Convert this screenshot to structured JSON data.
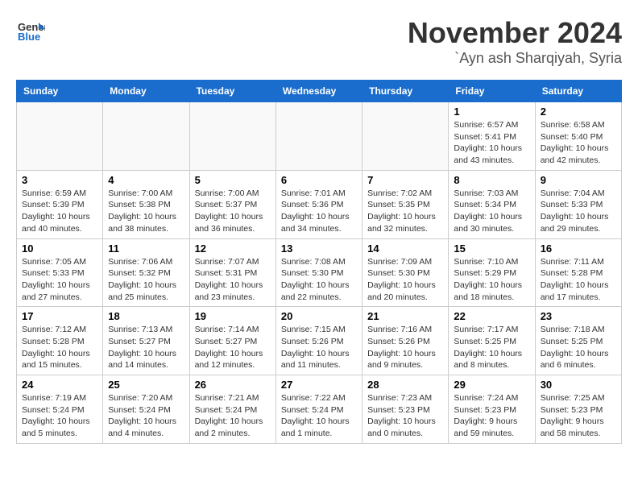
{
  "header": {
    "logo_general": "General",
    "logo_blue": "Blue",
    "month": "November 2024",
    "location": "`Ayn ash Sharqiyah, Syria"
  },
  "weekdays": [
    "Sunday",
    "Monday",
    "Tuesday",
    "Wednesday",
    "Thursday",
    "Friday",
    "Saturday"
  ],
  "weeks": [
    [
      {
        "day": "",
        "info": ""
      },
      {
        "day": "",
        "info": ""
      },
      {
        "day": "",
        "info": ""
      },
      {
        "day": "",
        "info": ""
      },
      {
        "day": "",
        "info": ""
      },
      {
        "day": "1",
        "info": "Sunrise: 6:57 AM\nSunset: 5:41 PM\nDaylight: 10 hours\nand 43 minutes."
      },
      {
        "day": "2",
        "info": "Sunrise: 6:58 AM\nSunset: 5:40 PM\nDaylight: 10 hours\nand 42 minutes."
      }
    ],
    [
      {
        "day": "3",
        "info": "Sunrise: 6:59 AM\nSunset: 5:39 PM\nDaylight: 10 hours\nand 40 minutes."
      },
      {
        "day": "4",
        "info": "Sunrise: 7:00 AM\nSunset: 5:38 PM\nDaylight: 10 hours\nand 38 minutes."
      },
      {
        "day": "5",
        "info": "Sunrise: 7:00 AM\nSunset: 5:37 PM\nDaylight: 10 hours\nand 36 minutes."
      },
      {
        "day": "6",
        "info": "Sunrise: 7:01 AM\nSunset: 5:36 PM\nDaylight: 10 hours\nand 34 minutes."
      },
      {
        "day": "7",
        "info": "Sunrise: 7:02 AM\nSunset: 5:35 PM\nDaylight: 10 hours\nand 32 minutes."
      },
      {
        "day": "8",
        "info": "Sunrise: 7:03 AM\nSunset: 5:34 PM\nDaylight: 10 hours\nand 30 minutes."
      },
      {
        "day": "9",
        "info": "Sunrise: 7:04 AM\nSunset: 5:33 PM\nDaylight: 10 hours\nand 29 minutes."
      }
    ],
    [
      {
        "day": "10",
        "info": "Sunrise: 7:05 AM\nSunset: 5:33 PM\nDaylight: 10 hours\nand 27 minutes."
      },
      {
        "day": "11",
        "info": "Sunrise: 7:06 AM\nSunset: 5:32 PM\nDaylight: 10 hours\nand 25 minutes."
      },
      {
        "day": "12",
        "info": "Sunrise: 7:07 AM\nSunset: 5:31 PM\nDaylight: 10 hours\nand 23 minutes."
      },
      {
        "day": "13",
        "info": "Sunrise: 7:08 AM\nSunset: 5:30 PM\nDaylight: 10 hours\nand 22 minutes."
      },
      {
        "day": "14",
        "info": "Sunrise: 7:09 AM\nSunset: 5:30 PM\nDaylight: 10 hours\nand 20 minutes."
      },
      {
        "day": "15",
        "info": "Sunrise: 7:10 AM\nSunset: 5:29 PM\nDaylight: 10 hours\nand 18 minutes."
      },
      {
        "day": "16",
        "info": "Sunrise: 7:11 AM\nSunset: 5:28 PM\nDaylight: 10 hours\nand 17 minutes."
      }
    ],
    [
      {
        "day": "17",
        "info": "Sunrise: 7:12 AM\nSunset: 5:28 PM\nDaylight: 10 hours\nand 15 minutes."
      },
      {
        "day": "18",
        "info": "Sunrise: 7:13 AM\nSunset: 5:27 PM\nDaylight: 10 hours\nand 14 minutes."
      },
      {
        "day": "19",
        "info": "Sunrise: 7:14 AM\nSunset: 5:27 PM\nDaylight: 10 hours\nand 12 minutes."
      },
      {
        "day": "20",
        "info": "Sunrise: 7:15 AM\nSunset: 5:26 PM\nDaylight: 10 hours\nand 11 minutes."
      },
      {
        "day": "21",
        "info": "Sunrise: 7:16 AM\nSunset: 5:26 PM\nDaylight: 10 hours\nand 9 minutes."
      },
      {
        "day": "22",
        "info": "Sunrise: 7:17 AM\nSunset: 5:25 PM\nDaylight: 10 hours\nand 8 minutes."
      },
      {
        "day": "23",
        "info": "Sunrise: 7:18 AM\nSunset: 5:25 PM\nDaylight: 10 hours\nand 6 minutes."
      }
    ],
    [
      {
        "day": "24",
        "info": "Sunrise: 7:19 AM\nSunset: 5:24 PM\nDaylight: 10 hours\nand 5 minutes."
      },
      {
        "day": "25",
        "info": "Sunrise: 7:20 AM\nSunset: 5:24 PM\nDaylight: 10 hours\nand 4 minutes."
      },
      {
        "day": "26",
        "info": "Sunrise: 7:21 AM\nSunset: 5:24 PM\nDaylight: 10 hours\nand 2 minutes."
      },
      {
        "day": "27",
        "info": "Sunrise: 7:22 AM\nSunset: 5:24 PM\nDaylight: 10 hours\nand 1 minute."
      },
      {
        "day": "28",
        "info": "Sunrise: 7:23 AM\nSunset: 5:23 PM\nDaylight: 10 hours\nand 0 minutes."
      },
      {
        "day": "29",
        "info": "Sunrise: 7:24 AM\nSunset: 5:23 PM\nDaylight: 9 hours\nand 59 minutes."
      },
      {
        "day": "30",
        "info": "Sunrise: 7:25 AM\nSunset: 5:23 PM\nDaylight: 9 hours\nand 58 minutes."
      }
    ]
  ]
}
